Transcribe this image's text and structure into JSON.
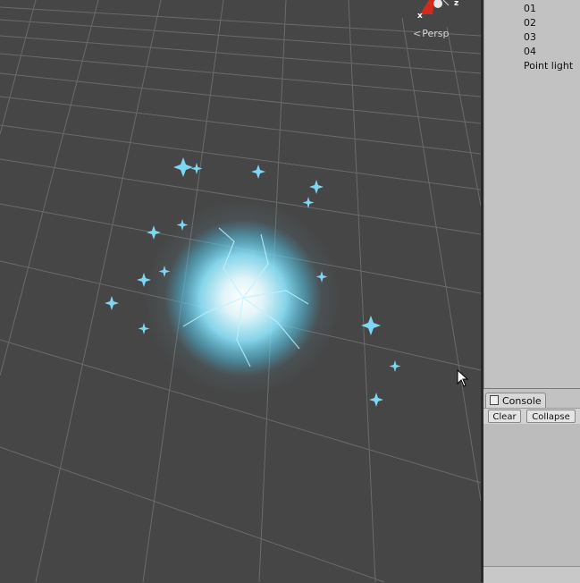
{
  "scene": {
    "projection_label": "Persp",
    "gizmo_axes": {
      "x": "x",
      "z": "z"
    }
  },
  "hierarchy": {
    "items": [
      "01",
      "02",
      "03",
      "04",
      "Point light"
    ]
  },
  "console": {
    "tab_label": "Console",
    "clear_label": "Clear",
    "collapse_label": "Collapse"
  },
  "colors": {
    "scene_bg": "#464646",
    "panel_bg": "#c2c2c2",
    "energy_glow": "#8fe8ff",
    "gizmo_x": "#d22a1b"
  },
  "icons": [
    "scene-gizmo-icon",
    "persp-chevron-icon",
    "console-tab-icon",
    "mouse-cursor-icon"
  ]
}
